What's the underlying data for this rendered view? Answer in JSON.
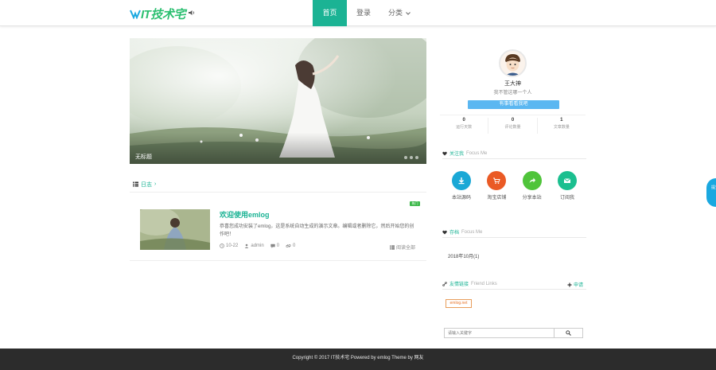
{
  "header": {
    "logo_text": "IT技术宅",
    "nav": [
      {
        "label": "首页",
        "active": true
      },
      {
        "label": "登录",
        "active": false
      },
      {
        "label": "分类",
        "active": false
      }
    ]
  },
  "hero": {
    "caption": "无标题",
    "dot_count": 3
  },
  "category_strip": {
    "label": "日志",
    "sep": "›"
  },
  "post": {
    "badge": "热门",
    "title": "欢迎使用emlog",
    "excerpt": "恭喜您成功安装了emlog，这是系统自动生成的演示文章。编辑或者删除它，然后开始您的创作吧！",
    "meta": {
      "date": "10-22",
      "author": "admin",
      "comments": "0",
      "views": "0"
    },
    "more": "阅读全部"
  },
  "profile": {
    "name": "王大神",
    "desc": "我不管这哪一个人",
    "button": "有事看看我吧",
    "stats": [
      {
        "num": "0",
        "label": "运行天数"
      },
      {
        "num": "0",
        "label": "评论数量"
      },
      {
        "num": "1",
        "label": "文章数量"
      }
    ]
  },
  "sidebar": {
    "follow": {
      "title": "关注我",
      "en": "Focus Me",
      "items": [
        {
          "label": "本站源码",
          "color": "#1aa8d6",
          "icon": "download-icon"
        },
        {
          "label": "淘宝店铺",
          "color": "#ea5a25",
          "icon": "cart-icon"
        },
        {
          "label": "分享本站",
          "color": "#4fc43a",
          "icon": "share-icon"
        },
        {
          "label": "订阅我",
          "color": "#1bbf8f",
          "icon": "mail-icon"
        }
      ]
    },
    "archive": {
      "title": "存档",
      "en": "Focus Me",
      "items": [
        "2018年10月(1)"
      ]
    },
    "links": {
      "title": "友情链接",
      "en": "Friend Links",
      "add_label": "申请",
      "items": [
        "emlog.net"
      ]
    },
    "search": {
      "placeholder": "请输入关键字"
    }
  },
  "float_tab": {
    "label": "提交"
  },
  "footer": {
    "text": "Copyright © 2017 IT技术宅 Powered by emlog Theme by 网友"
  },
  "colors": {
    "accent": "#1bb394",
    "primary_blue": "#5bb7f1",
    "footer_bg": "#2c2c2c"
  }
}
